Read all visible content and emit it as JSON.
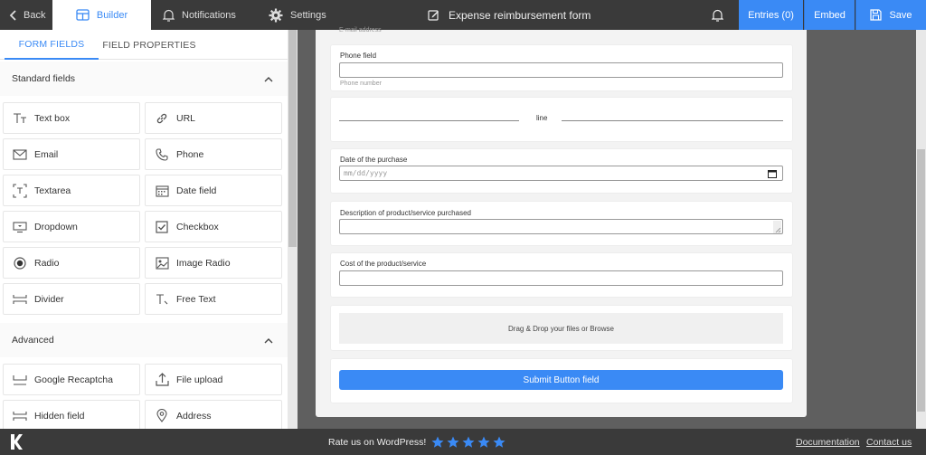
{
  "topbar": {
    "back_label": "Back",
    "builder_label": "Builder",
    "notifications_label": "Notifications",
    "settings_label": "Settings",
    "form_title": "Expense reimbursement form",
    "entries_label": "Entries (0)",
    "embed_label": "Embed",
    "save_label": "Save"
  },
  "panel": {
    "tab_form_fields": "FORM FIELDS",
    "tab_field_properties": "FIELD PROPERTIES",
    "standard_heading": "Standard fields",
    "advanced_heading": "Advanced",
    "standard_fields": [
      {
        "label": "Text box",
        "icon": "text-box-icon"
      },
      {
        "label": "URL",
        "icon": "link-icon"
      },
      {
        "label": "Email",
        "icon": "envelope-icon"
      },
      {
        "label": "Phone",
        "icon": "phone-icon"
      },
      {
        "label": "Textarea",
        "icon": "textarea-icon"
      },
      {
        "label": "Date field",
        "icon": "calendar-icon"
      },
      {
        "label": "Dropdown",
        "icon": "dropdown-icon"
      },
      {
        "label": "Checkbox",
        "icon": "checkbox-icon"
      },
      {
        "label": "Radio",
        "icon": "radio-icon"
      },
      {
        "label": "Image Radio",
        "icon": "image-radio-icon"
      },
      {
        "label": "Divider",
        "icon": "divider-icon"
      },
      {
        "label": "Free Text",
        "icon": "free-text-icon"
      }
    ],
    "advanced_fields": [
      {
        "label": "Google Recaptcha",
        "icon": "recaptcha-icon"
      },
      {
        "label": "File upload",
        "icon": "upload-icon"
      },
      {
        "label": "Hidden field",
        "icon": "hidden-field-icon"
      },
      {
        "label": "Address",
        "icon": "location-pin-icon"
      }
    ]
  },
  "form": {
    "email_hint": "E-mail address",
    "phone_label": "Phone field",
    "phone_hint": "Phone number",
    "divider_text": "line",
    "date_label": "Date of the purchase",
    "date_placeholder": "mm/dd/yyyy",
    "description_label": "Description of product/service purchased",
    "cost_label": "Cost of the product/service",
    "dropzone_text": "Drag & Drop your files or Browse",
    "submit_label": "Submit Button field"
  },
  "footer": {
    "rate_label": "Rate us on WordPress!",
    "star_count": 5,
    "documentation_label": "Documentation",
    "contact_label": "Contact us",
    "star_color": "#3a8af5"
  }
}
